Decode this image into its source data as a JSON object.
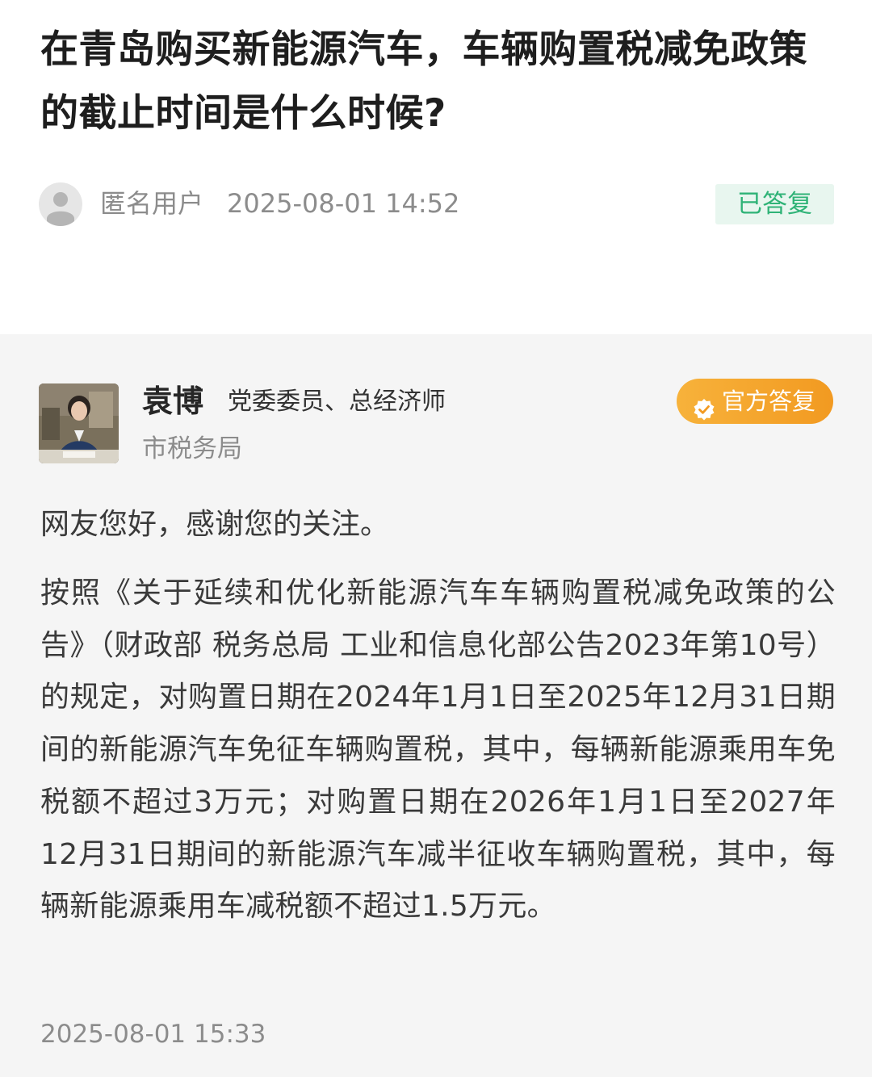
{
  "question": {
    "title": "在青岛购买新能源汽车，车辆购置税减免政策的截止时间是什么时候?",
    "user": "匿名用户",
    "time": "2025-08-01 14:52",
    "status": "已答复",
    "status_color": "#2fb377",
    "avatar_icon": "user-avatar-icon"
  },
  "answer": {
    "responder_name": "袁博",
    "responder_title": "党委委员、总经济师",
    "department": "市税务局",
    "badge": "官方答复",
    "badge_color": "#f5a52e",
    "badge_icon": "verified-check-icon",
    "greeting": "网友您好，感谢您的关注。",
    "body": "按照《关于延续和优化新能源汽车车辆购置税减免政策的公告》（财政部 税务总局 工业和信息化部公告2023年第10号）的规定，对购置日期在2024年1月1日至2025年12月31日期间的新能源汽车免征车辆购置税，其中，每辆新能源乘用车免税额不超过3万元；对购置日期在2026年1月1日至2027年12月31日期间的新能源汽车减半征收车辆购置税，其中，每辆新能源乘用车减税额不超过1.5万元。",
    "time": "2025-08-01 15:33"
  }
}
